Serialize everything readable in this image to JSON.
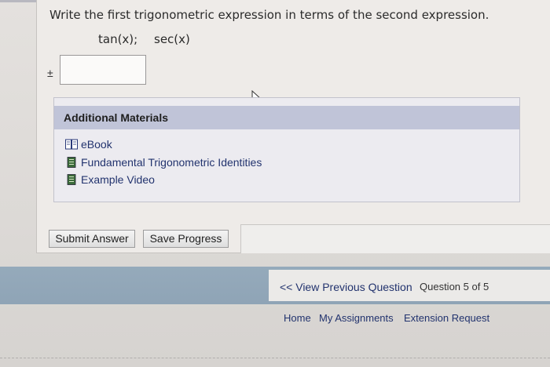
{
  "question": {
    "prompt": "Write the first trigonometric expression in terms of the second expression.",
    "expression_a": "tan(x);",
    "expression_b": "sec(x)",
    "plus_minus": "±",
    "answer_value": ""
  },
  "materials": {
    "title": "Additional Materials",
    "items": [
      {
        "label": "eBook",
        "icon": "book-icon"
      },
      {
        "label": "Fundamental Trigonometric Identities",
        "icon": "document-icon"
      },
      {
        "label": "Example Video",
        "icon": "document-icon"
      }
    ]
  },
  "actions": {
    "submit_label": "Submit Answer",
    "save_label": "Save Progress"
  },
  "navigation": {
    "prev_label": "<< View Previous Question",
    "count_label": "Question 5 of 5"
  },
  "footer_links": {
    "home": "Home",
    "assignments": "My Assignments",
    "extension": "Extension Request"
  },
  "colors": {
    "link": "#22336e",
    "materials_header": "#c0c4d8",
    "footer_bar": "#95aabb"
  }
}
